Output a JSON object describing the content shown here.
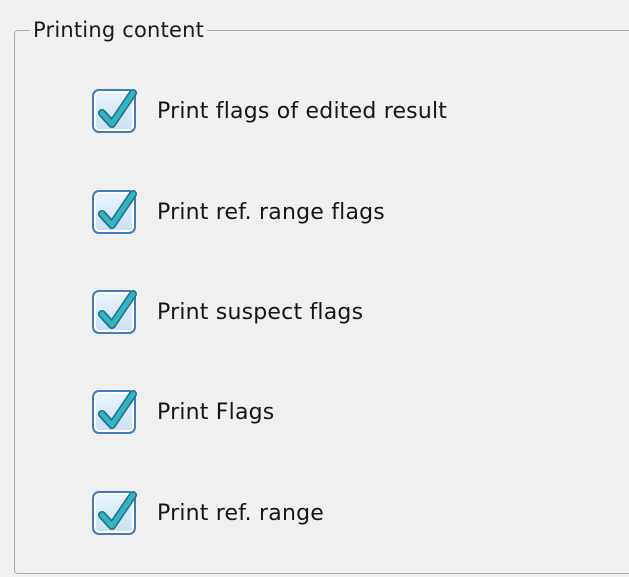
{
  "group": {
    "title": "Printing content"
  },
  "options": [
    {
      "label": "Print flags of edited result",
      "checked": true
    },
    {
      "label": "Print ref. range flags",
      "checked": true
    },
    {
      "label": "Print suspect flags",
      "checked": true
    },
    {
      "label": "Print Flags",
      "checked": true
    },
    {
      "label": "Print ref. range",
      "checked": true
    }
  ],
  "colors": {
    "checkmark": "#2fa6b8",
    "checkbox_border": "#3f7db8",
    "panel_background": "#f0f0f0"
  }
}
